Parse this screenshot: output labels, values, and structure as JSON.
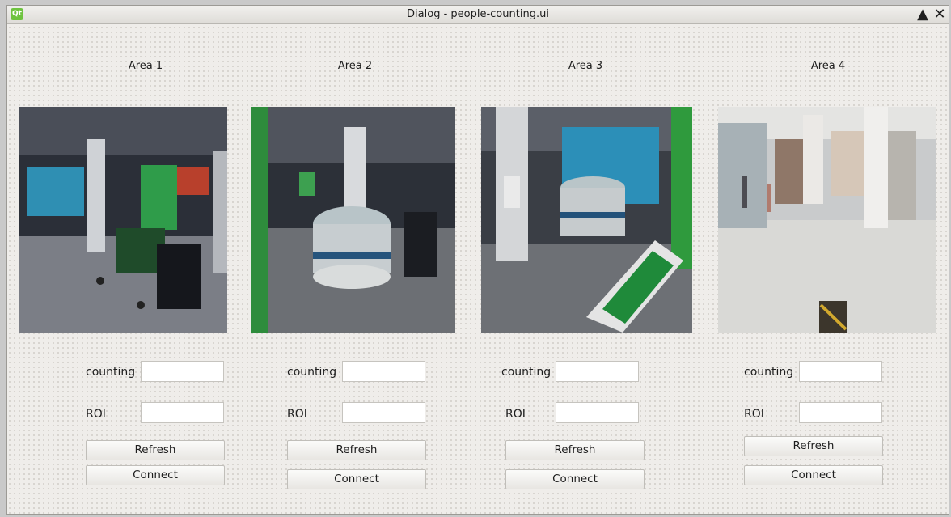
{
  "window": {
    "title": "Dialog - people-counting.ui",
    "app_icon_text": "Qt",
    "buttons": {
      "maximize": "▲",
      "close": "✕"
    }
  },
  "areas": [
    {
      "title": "Area 1",
      "counting_label": "counting",
      "counting_value": "",
      "roi_label": "ROI",
      "roi_value": "",
      "refresh_label": "Refresh",
      "connect_label": "Connect"
    },
    {
      "title": "Area 2",
      "counting_label": "counting",
      "counting_value": "",
      "roi_label": "ROI",
      "roi_value": "",
      "refresh_label": "Refresh",
      "connect_label": "Connect"
    },
    {
      "title": "Area 3",
      "counting_label": "counting",
      "counting_value": "",
      "roi_label": "ROI",
      "roi_value": "",
      "refresh_label": "Refresh",
      "connect_label": "Connect"
    },
    {
      "title": "Area 4",
      "counting_label": "counting",
      "counting_value": "",
      "roi_label": "ROI",
      "roi_value": "",
      "refresh_label": "Refresh",
      "connect_label": "Connect"
    }
  ]
}
